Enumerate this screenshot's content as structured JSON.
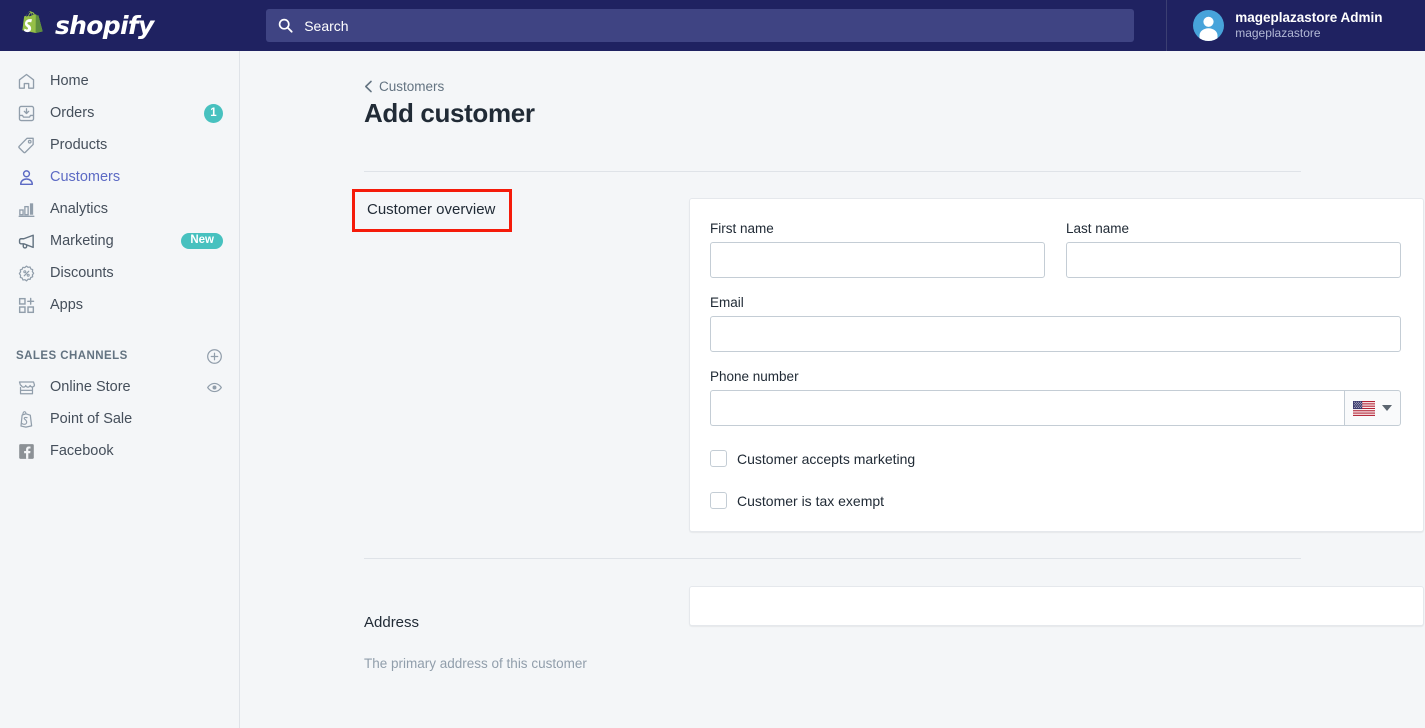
{
  "topbar": {
    "brand_word": "shopify",
    "brand_logo_icon": "shopify-bag-icon",
    "search": {
      "icon": "search-icon",
      "placeholder": "Search",
      "value": ""
    },
    "account": {
      "avatar_icon": "user-avatar-icon",
      "name": "mageplazastore Admin",
      "store": "mageplazastore"
    }
  },
  "sidebar": {
    "items": [
      {
        "label": "Home",
        "icon": "home-icon",
        "active": false
      },
      {
        "label": "Orders",
        "icon": "orders-inbox-icon",
        "active": false,
        "badge_count": "1"
      },
      {
        "label": "Products",
        "icon": "tag-icon",
        "active": false
      },
      {
        "label": "Customers",
        "icon": "person-icon",
        "active": true
      },
      {
        "label": "Analytics",
        "icon": "bar-chart-icon",
        "active": false
      },
      {
        "label": "Marketing",
        "icon": "megaphone-icon",
        "active": false,
        "badge_new": "New"
      },
      {
        "label": "Discounts",
        "icon": "discount-percent-icon",
        "active": false
      },
      {
        "label": "Apps",
        "icon": "apps-grid-plus-icon",
        "active": false
      }
    ],
    "section": {
      "title": "SALES CHANNELS",
      "add_icon": "circle-plus-icon",
      "channels": [
        {
          "label": "Online Store",
          "icon": "storefront-icon",
          "action_icon": "eye-icon"
        },
        {
          "label": "Point of Sale",
          "icon": "shopify-bag-outline-icon"
        },
        {
          "label": "Facebook",
          "icon": "facebook-icon"
        }
      ]
    }
  },
  "main": {
    "breadcrumb": {
      "label": "Customers",
      "icon": "chevron-left-icon"
    },
    "page_title": "Add customer",
    "overview": {
      "section_label": "Customer overview",
      "annotated": true,
      "annotation_color": "#f51b0a",
      "fields": {
        "first_name": {
          "label": "First name",
          "value": "",
          "placeholder": ""
        },
        "last_name": {
          "label": "Last name",
          "value": "",
          "placeholder": ""
        },
        "email": {
          "label": "Email",
          "value": "",
          "placeholder": ""
        },
        "phone": {
          "label": "Phone number",
          "value": "",
          "placeholder": "",
          "country_flag": "us-flag-icon",
          "caret_icon": "chevron-down-icon"
        }
      },
      "checkboxes": [
        {
          "label": "Customer accepts marketing",
          "checked": false
        },
        {
          "label": "Customer is tax exempt",
          "checked": false
        }
      ]
    },
    "address": {
      "section_label": "Address",
      "section_help": "The primary address of this customer"
    }
  },
  "colors": {
    "topbar_bg": "#1f2261",
    "search_bg": "#3f4483",
    "accent_indigo": "#5c6ac4",
    "badge_teal": "#47c1bf",
    "page_bg": "#f4f6f8",
    "annotation_red": "#f51b0a"
  }
}
